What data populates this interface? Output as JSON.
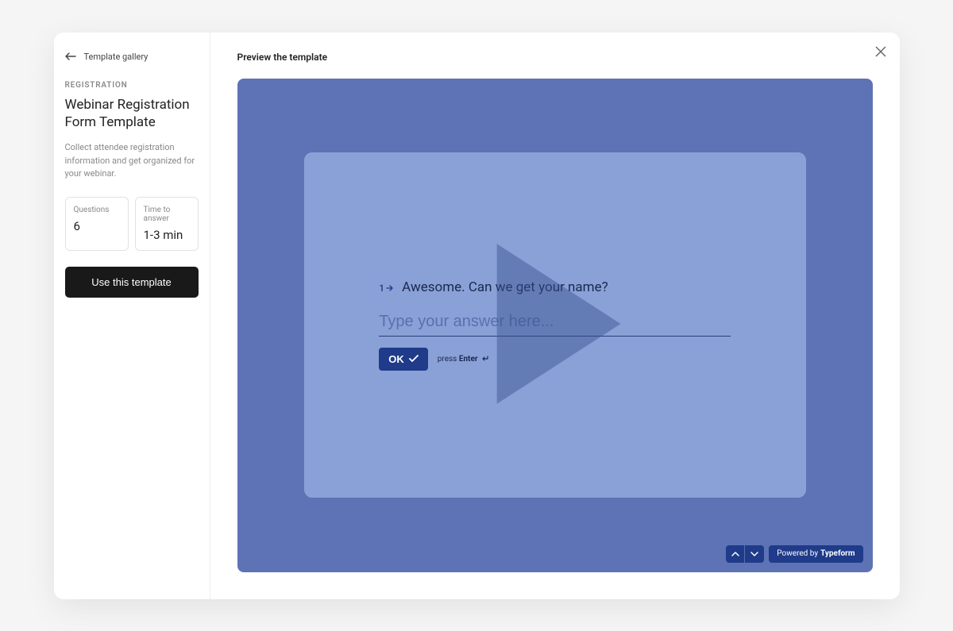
{
  "sidebar": {
    "back_label": "Template gallery",
    "category": "REGISTRATION",
    "title": "Webinar Registration Form Template",
    "description": "Collect attendee registration information and get organized for your webinar.",
    "stats": {
      "questions_label": "Questions",
      "questions_value": "6",
      "time_label": "Time to answer",
      "time_value": "1-3 min"
    },
    "cta_label": "Use this template"
  },
  "main": {
    "heading": "Preview the template",
    "question_number": "1",
    "question_text": "Awesome. Can we get your name?",
    "input_placeholder": "Type your answer here...",
    "ok_label": "OK",
    "hint_prefix": "press ",
    "hint_key": "Enter",
    "powered_prefix": "Powered by ",
    "powered_brand": "Typeform"
  }
}
